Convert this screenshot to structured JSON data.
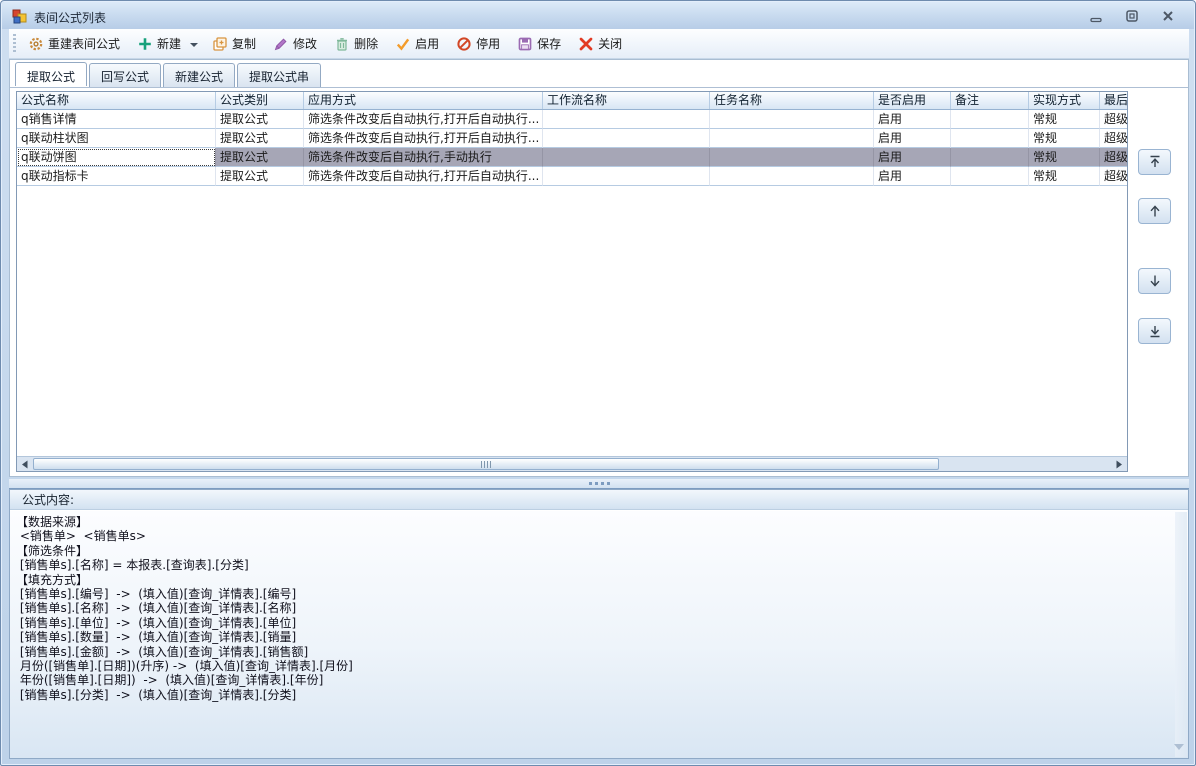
{
  "window": {
    "title": "表间公式列表"
  },
  "toolbar": {
    "items": [
      {
        "label": "重建表间公式",
        "icon": "gear-icon"
      },
      {
        "label": "新建",
        "icon": "plus-icon",
        "has_dropdown": true
      },
      {
        "label": "复制",
        "icon": "copy-icon"
      },
      {
        "label": "修改",
        "icon": "pencil-icon"
      },
      {
        "label": "删除",
        "icon": "trash-icon"
      },
      {
        "label": "启用",
        "icon": "check-icon"
      },
      {
        "label": "停用",
        "icon": "disable-icon"
      },
      {
        "label": "保存",
        "icon": "save-icon"
      },
      {
        "label": "关闭",
        "icon": "close-x-icon"
      }
    ]
  },
  "tabs": {
    "items": [
      "提取公式",
      "回写公式",
      "新建公式",
      "提取公式串"
    ],
    "active": "提取公式"
  },
  "grid": {
    "columns": [
      "公式名称",
      "公式类别",
      "应用方式",
      "工作流名称",
      "任务名称",
      "是否启用",
      "备注",
      "实现方式",
      "最后"
    ],
    "rows": [
      [
        "q销售详情",
        "提取公式",
        "筛选条件改变后自动执行,打开后自动执行...",
        "",
        "",
        "启用",
        "",
        "常规",
        "超级"
      ],
      [
        "q联动柱状图",
        "提取公式",
        "筛选条件改变后自动执行,打开后自动执行...",
        "",
        "",
        "启用",
        "",
        "常规",
        "超级"
      ],
      [
        "q联动饼图",
        "提取公式",
        "筛选条件改变后自动执行,手动执行",
        "",
        "",
        "启用",
        "",
        "常规",
        "超级"
      ],
      [
        "q联动指标卡",
        "提取公式",
        "筛选条件改变后自动执行,打开后自动执行...",
        "",
        "",
        "启用",
        "",
        "常规",
        "超级"
      ]
    ],
    "selected_row": "q联动饼图"
  },
  "side_buttons": {
    "move_top": "move-to-top",
    "move_up": "move-up",
    "move_down": "move-down",
    "move_bottom": "move-to-bottom"
  },
  "formula_panel": {
    "label": "公式内容:",
    "content": "【数据来源】\n <销售单>  <销售单s>\n【筛选条件】\n [销售单s].[名称] = 本报表.[查询表].[分类]\n【填充方式】\n [销售单s].[编号]  ->  (填入值)[查询_详情表].[编号]\n [销售单s].[名称]  ->  (填入值)[查询_详情表].[名称]\n [销售单s].[单位]  ->  (填入值)[查询_详情表].[单位]\n [销售单s].[数量]  ->  (填入值)[查询_详情表].[销量]\n [销售单s].[金额]  ->  (填入值)[查询_详情表].[销售额]\n 月份([销售单].[日期])(升序) ->  (填入值)[查询_详情表].[月份]\n 年份([销售单].[日期])  ->  (填入值)[查询_详情表].[年份]\n [销售单s].[分类]  ->  (填入值)[查询_详情表].[分类]"
  },
  "colors": {
    "titlebar": "#cadcf0",
    "selection_bg": "#a6a6b6",
    "grid_header_bg": "#e2ecf7",
    "accent_green": "#17a17b",
    "accent_orange": "#e09a3c",
    "accent_red": "#d94226",
    "accent_purple": "#9b6bb3"
  }
}
